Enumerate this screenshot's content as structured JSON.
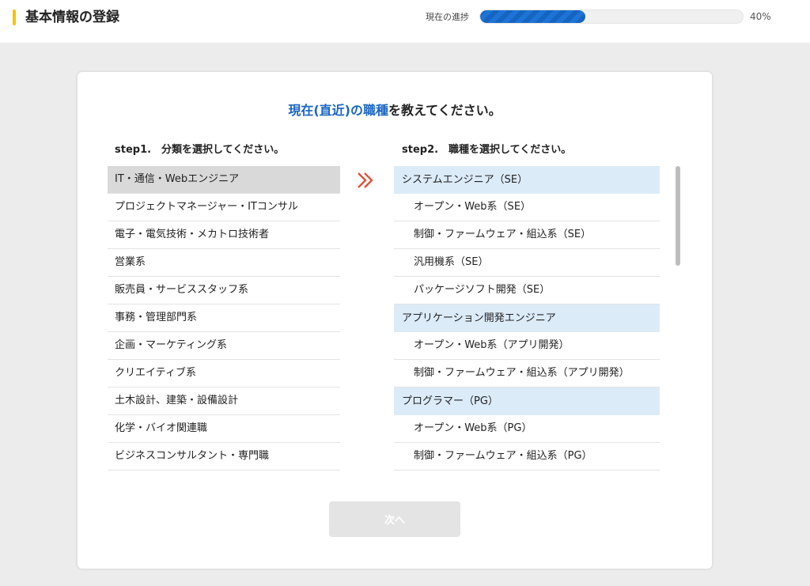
{
  "header": {
    "title": "基本情報の登録",
    "progress_label": "現在の進捗",
    "progress_value": "40%",
    "progress_fraction": 0.4
  },
  "question": {
    "highlight": "現在(直近)の職種",
    "rest": "を教えてください。"
  },
  "step1": {
    "heading": "step1.　分類を選択してください。",
    "selected_index": 0,
    "items": [
      "IT・通信・Webエンジニア",
      "プロジェクトマネージャー・ITコンサル",
      "電子・電気技術・メカトロ技術者",
      "営業系",
      "販売員・サービススタッフ系",
      "事務・管理部門系",
      "企画・マーケティング系",
      "クリエイティブ系",
      "土木設計、建築・設備設計",
      "化学・バイオ関連職",
      "ビジネスコンサルタント・専門職"
    ]
  },
  "step2": {
    "heading": "step2.　職種を選択してください。",
    "groups": [
      {
        "label": "システムエンジニア（SE）",
        "items": [
          "オープン・Web系（SE）",
          "制御・ファームウェア・組込系（SE）",
          "汎用機系（SE）",
          "パッケージソフト開発（SE）"
        ]
      },
      {
        "label": "アプリケーション開発エンジニア",
        "items": [
          "オープン・Web系（アプリ開発）",
          "制御・ファームウェア・組込系（アプリ開発）"
        ]
      },
      {
        "label": "プログラマー（PG）",
        "items": [
          "オープン・Web系（PG）",
          "制御・ファームウェア・組込系（PG）"
        ]
      }
    ]
  },
  "next_button": {
    "label": "次へ",
    "disabled": true
  },
  "icons": {
    "arrow": "double-chevron-right-icon"
  },
  "colors": {
    "accent_yellow": "#f5c400",
    "progress_blue": "#1565c0",
    "highlight_blue": "#1a66c4",
    "arrow_red": "#e0533a",
    "selected_gray": "#d9d9d9",
    "group_bg": "#dcebf8"
  }
}
